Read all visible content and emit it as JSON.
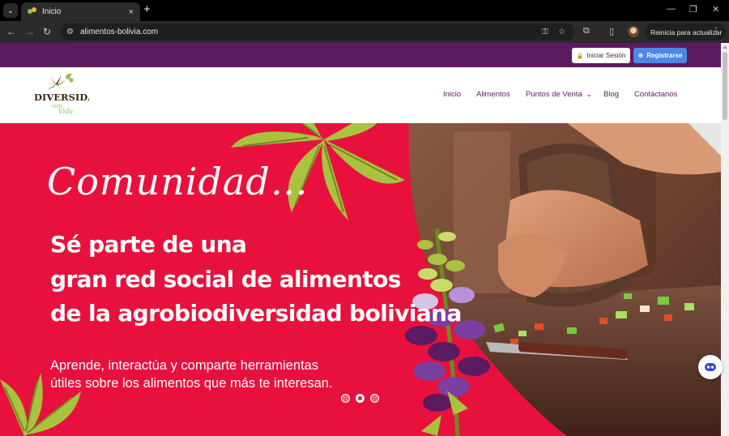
{
  "browser": {
    "tab_title": "Inicio",
    "tab_close": "×",
    "new_tab": "+",
    "url": "alimentos-bolivia.com",
    "relaunch_label": "Reinicia para actualizar",
    "relaunch_menu": "⋮",
    "tab_search": "⌄",
    "back": "←",
    "forward": "→",
    "reload": "↻",
    "site_info": "⚙",
    "password_key": "⚿",
    "bookmark": "☆",
    "extensions": "⧉",
    "sidebar": "▯",
    "minimize": "—",
    "restore": "❐",
    "close": "✕"
  },
  "topbar": {
    "login_label": "Iniciar Sesión",
    "register_label": "Registrarse",
    "lock_icon": "🔒",
    "globe_icon": "⊕"
  },
  "nav": {
    "items": [
      {
        "label": "Inicio"
      },
      {
        "label": "Alimentos"
      },
      {
        "label": "Puntos de Venta"
      },
      {
        "label": "Blog"
      },
      {
        "label": "Contáctanos"
      }
    ],
    "dropdown_chevron": "⌄"
  },
  "logo": {
    "line1": "DIVERSIDAD",
    "line2": "con",
    "line3": "Vida"
  },
  "hero": {
    "script_title": "Comunidad…",
    "headline": [
      "Sé parte de una",
      "gran red social de alimentos",
      "de la agrobiodiversidad boliviana"
    ],
    "subtext": [
      "Aprende, interactúa y comparte herramientas",
      "útiles sobre los alimentos que más te interesan."
    ],
    "slide_count": 3,
    "active_slide": 2
  },
  "colors": {
    "brand_purple": "#5c1a61",
    "hero_red": "#e8113e",
    "register_blue": "#4b89e8",
    "leaf_green": "#8cc34a"
  }
}
